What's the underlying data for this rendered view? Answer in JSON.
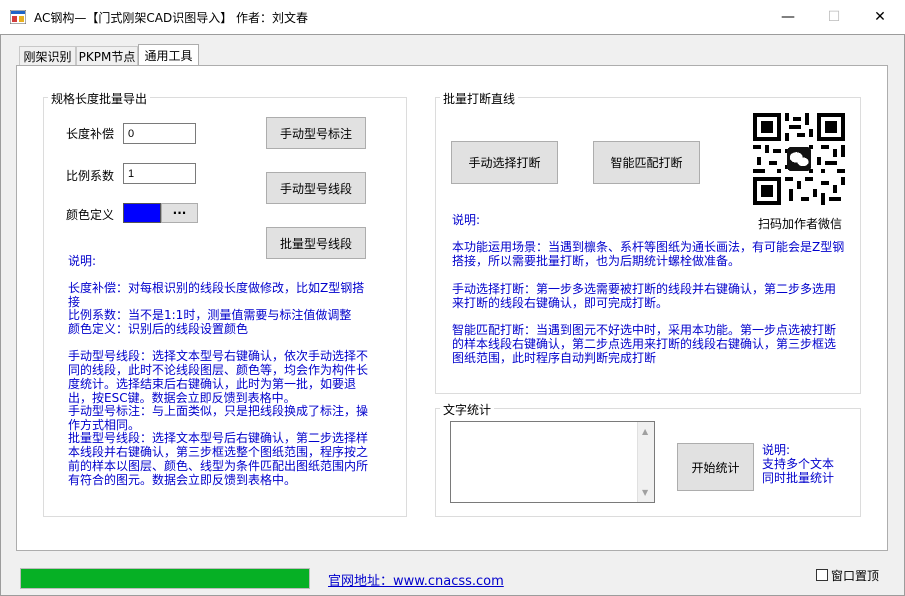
{
  "window": {
    "title": "AC钢构—【门式刚架CAD识图导入】 作者：刘文春",
    "minimize": "—",
    "maximize": "☐",
    "close": "✕"
  },
  "tabs": [
    {
      "label": "刚架识别"
    },
    {
      "label": "PKPM节点"
    },
    {
      "label": "通用工具"
    }
  ],
  "export_group": {
    "title": "规格长度批量导出",
    "length_label": "长度补偿",
    "length_value": "0",
    "scale_label": "比例系数",
    "scale_value": "1",
    "color_label": "颜色定义",
    "color_value": "#0000ff",
    "color_pick": "···",
    "btn_manual_label": "手动型号标注",
    "btn_manual_line": "手动型号线段",
    "btn_batch_line": "批量型号线段",
    "desc_title": "说明:",
    "desc_lines": [
      "长度补偿：对每根识别的线段长度做修改，比如Z型钢搭接",
      "比例系数：当不是1:1时，测量值需要与标注值做调整",
      "颜色定义：识别后的线段设置颜色",
      "手动型号线段：选择文本型号右键确认，依次手动选择不同的线段，此时不论线段图层、颜色等，均会作为构件长度统计。选择结束后右键确认，此时为第一批，如要退出，按ESC键。数据会立即反馈到表格中。",
      "手动型号标注：与上面类似，只是把线段换成了标注，操作方式相同。",
      "批量型号线段：选择文本型号后右键确认，第二步选择样本线段并右键确认，第三步框选整个图纸范围，程序按之前的样本以图层、颜色、线型为条件匹配出图纸范围内所有符合的图元。数据会立即反馈到表格中。"
    ]
  },
  "break_group": {
    "title": "批量打断直线",
    "btn_manual": "手动选择打断",
    "btn_smart": "智能匹配打断",
    "qr_caption": "扫码加作者微信",
    "desc_title": "说明:",
    "desc_lines": [
      "本功能运用场景：当遇到檩条、系杆等图纸为通长画法，有可能会是Z型钢搭接，所以需要批量打断，也为后期统计螺栓做准备。",
      "手动选择打断：第一步多选需要被打断的线段并右键确认，第二步多选用来打断的线段右键确认，即可完成打断。",
      "智能匹配打断：当遇到图元不好选中时，采用本功能。第一步点选被打断的样本线段右键确认，第二步点选用来打断的线段右键确认，第三步框选图纸范围，此时程序自动判断完成打断"
    ]
  },
  "text_group": {
    "title": "文字统计",
    "btn_start": "开始统计",
    "desc_lines": [
      "说明:",
      "支持多个文本",
      "同时批量统计"
    ]
  },
  "status": {
    "progress": 1.0,
    "website": "官网地址：www.cnacss.com",
    "topmost_label": "窗口置顶",
    "topmost_checked": false
  },
  "colors": {
    "progress": "#06b025",
    "accent_text": "#0000cc"
  }
}
